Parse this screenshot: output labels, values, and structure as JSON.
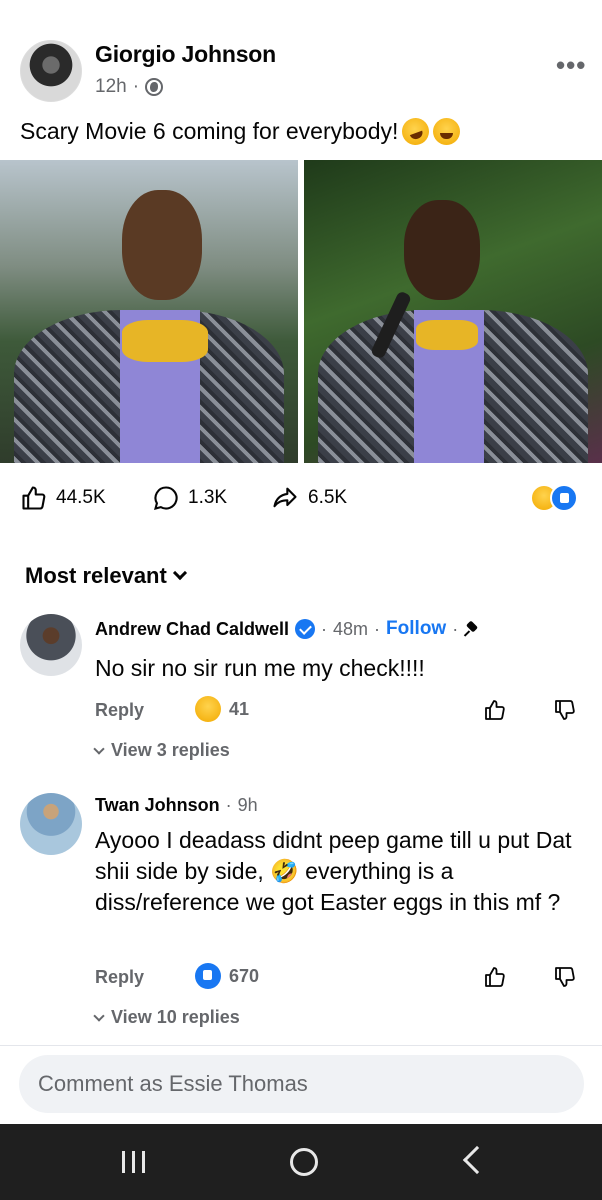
{
  "post": {
    "author": "Giorgio Johnson",
    "time": "12h",
    "separator": "·",
    "caption": "Scary Movie 6 coming for everybody!",
    "more_menu": "•••"
  },
  "stats": {
    "likes": "44.5K",
    "comments": "1.3K",
    "shares": "6.5K"
  },
  "sort": {
    "label": "Most relevant"
  },
  "comments": [
    {
      "name": "Andrew Chad Caldwell",
      "time": "48m",
      "follow": "Follow",
      "text": "No sir no sir run me my check!!!!",
      "reply": "Reply",
      "reaction_count": "41",
      "view_replies": "View 3 replies"
    },
    {
      "name": "Twan Johnson",
      "time": "9h",
      "text": "Ayooo I deadass didnt peep game till u put Dat shii side by side, 🤣 everything is a diss/reference we got Easter eggs in this mf ?",
      "reply": "Reply",
      "reaction_count": "670",
      "view_replies": "View 10 replies"
    }
  ],
  "composer": {
    "placeholder": "Comment as Essie Thomas"
  },
  "icons": {
    "like": "thumbs-up-icon",
    "comment": "comment-bubble-icon",
    "share": "share-arrow-icon"
  },
  "colors": {
    "accent": "#1877f2",
    "muted": "#65676b",
    "navbar": "#1f1f1f"
  }
}
